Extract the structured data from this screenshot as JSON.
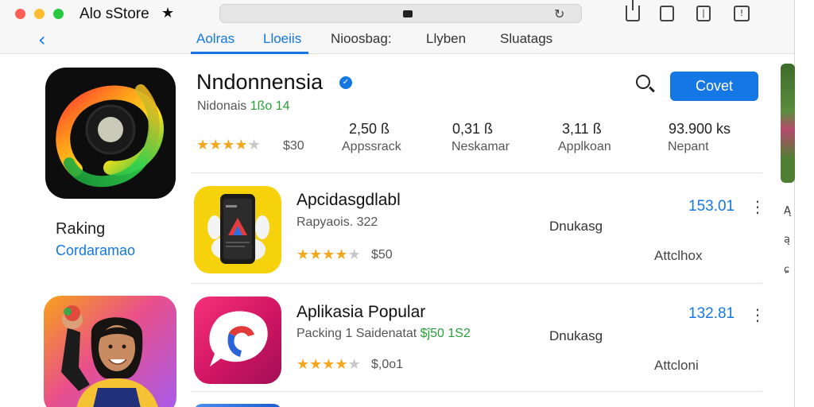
{
  "window": {
    "title": "Alo sStore",
    "star_glyph": "★"
  },
  "toolbar": {
    "reload_glyph": "↻",
    "sidebar_glyph": "❘",
    "tabs_glyph": "!"
  },
  "nav": {
    "back_glyph": "‹",
    "tabs": [
      "Aolras",
      "Lloeiis",
      "Nioosbag:",
      "Llyben",
      "Sluatags"
    ]
  },
  "left": {
    "ranking_label": "Raking",
    "ranking_link": "Cordaramao"
  },
  "header": {
    "name": "Nndonnensia",
    "verified_glyph": "✓",
    "subtitle_text": "Nidonais",
    "subtitle_num": "1ßo 14",
    "get_button": "Covet",
    "stars": [
      "on",
      "on",
      "on",
      "on",
      "off"
    ],
    "rating": 3.5,
    "rating_count": "$30",
    "stats": [
      {
        "value": "2,50 ß",
        "label": "Appssrack"
      },
      {
        "value": "0,31 ß",
        "label": "Neskamar"
      },
      {
        "value": "3,11 ß",
        "label": "Applkoan"
      },
      {
        "value": "93.900 ks",
        "label": "Nepant"
      }
    ]
  },
  "rows": [
    {
      "title": "Apcidasgdlabl",
      "subtitle": "Rapyaois. 322",
      "subtitle_green": "",
      "stars": [
        "on",
        "on",
        "on",
        "on",
        "off"
      ],
      "rating_count": "$50",
      "mid": "Dnukasg",
      "price": "153.01",
      "more": "⋮",
      "action": "Attclhox"
    },
    {
      "title": "Aplikasia Popular",
      "subtitle": "Packing 1 Saidenatat ",
      "subtitle_green": "$ĵ50 1S2",
      "stars": [
        "on",
        "on",
        "on",
        "on",
        "off"
      ],
      "rating_count": "$,0o1",
      "mid": "Dnukasg",
      "price": "132.81",
      "more": "⋮",
      "action": "Attcloni"
    }
  ],
  "sliver": {
    "glyphs": [
      "Ą",
      "ą",
      "ɕ"
    ]
  },
  "colors": {
    "accent": "#1577e3",
    "star": "#f2a81d",
    "green_text": "#2a9d3a"
  }
}
